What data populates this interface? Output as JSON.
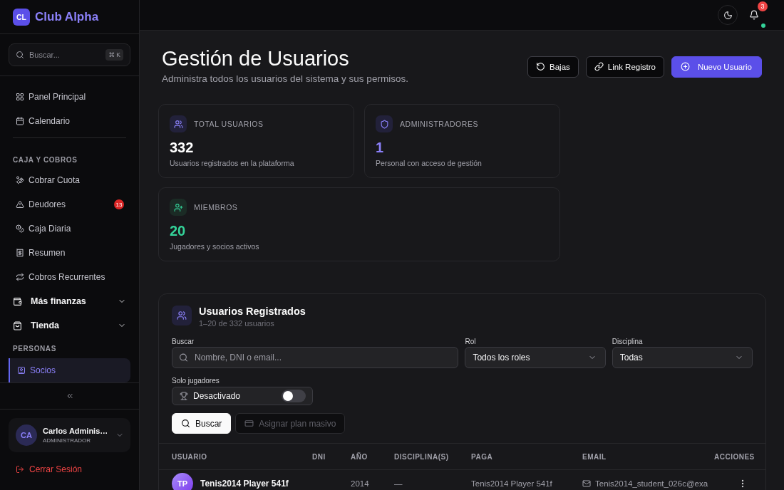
{
  "sidebar": {
    "logo": {
      "initials": "CL",
      "name": "Club Alpha"
    },
    "search": {
      "placeholder": "Buscar...",
      "shortcut": "⌘ K"
    },
    "sections": [
      {
        "items": [
          {
            "kind": "link",
            "label": "Panel Principal",
            "selected": false
          },
          {
            "kind": "link",
            "label": "Calendario",
            "selected": false
          }
        ]
      },
      {
        "title": "CAJA Y COBROS",
        "items": [
          {
            "kind": "link",
            "label": "Cobrar Cuota",
            "selected": false
          },
          {
            "kind": "link",
            "label": "Deudores",
            "selected": false,
            "badge": "13"
          },
          {
            "kind": "link",
            "label": "Caja Diaria",
            "selected": false
          },
          {
            "kind": "link",
            "label": "Resumen",
            "selected": false
          },
          {
            "kind": "link",
            "label": "Cobros Recurrentes",
            "selected": false
          },
          {
            "kind": "group",
            "label": "Más finanzas",
            "selected": false,
            "expanded": false
          },
          {
            "kind": "group",
            "label": "Tienda",
            "selected": false,
            "expanded": false
          }
        ]
      },
      {
        "title": "PERSONAS",
        "items": [
          {
            "kind": "link",
            "label": "Socios",
            "selected": true
          }
        ]
      }
    ],
    "user": {
      "initials": "CA",
      "name": "Carlos Adminis…",
      "role": "ADMINISTRADOR"
    },
    "logout": "Cerrar Sesión"
  },
  "topbar": {
    "notifications": "3",
    "online": true
  },
  "header": {
    "title": "Gestión de Usuarios",
    "subtitle": "Administra todos los usuarios del sistema y sus permisos.",
    "buttons": [
      {
        "kind": "outline",
        "label": "Bajas"
      },
      {
        "kind": "outline",
        "label": "Link Registro"
      },
      {
        "kind": "primary",
        "label": "Nuevo Usuario"
      }
    ]
  },
  "stats": [
    {
      "label": "TOTAL USUARIOS",
      "value": "332",
      "caption": "Usuarios registrados en la plataforma",
      "color": "#ffffff"
    },
    {
      "label": "ADMINISTRADORES",
      "value": "1",
      "caption": "Personal con acceso de gestión",
      "color": "#8b80f9"
    },
    {
      "label": "MIEMBROS",
      "value": "20",
      "caption": "Jugadores y socios activos",
      "color": "#34d399"
    }
  ],
  "users_panel": {
    "title": "Usuarios Registrados",
    "subtitle": "1–20 de 332 usuarios",
    "filters": {
      "search": {
        "label": "Buscar",
        "placeholder": "Nombre, DNI o email..."
      },
      "role": {
        "label": "Rol",
        "value": "Todos los roles"
      },
      "discipline": {
        "label": "Disciplina",
        "value": "Todas"
      },
      "players_only": {
        "label": "Solo jugadores",
        "text": "Desactivado",
        "on": false
      }
    },
    "actions": [
      {
        "kind": "primary",
        "label": "Buscar",
        "disabled": false
      },
      {
        "kind": "secondary",
        "label": "Asignar plan masivo",
        "disabled": true
      }
    ],
    "table": {
      "columns": [
        "USUARIO",
        "DNI",
        "AÑO",
        "DISCIPLINA(S)",
        "PAGA",
        "EMAIL",
        "ACCIONES"
      ],
      "rows": [
        {
          "initials": "TP",
          "name": "Tenis2014 Player 541f",
          "year": "2014",
          "disciplines": "—",
          "paga": "Tenis2014 Player 541f",
          "email": "Tenis2014_student_026c@exa"
        }
      ]
    }
  }
}
